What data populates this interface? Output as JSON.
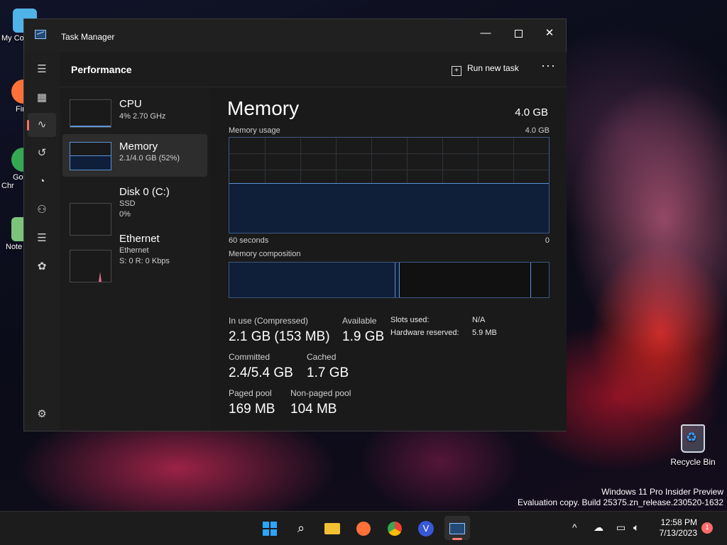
{
  "desktop": {
    "icons": [
      {
        "label": "My Co",
        "color": "#4fb3e8"
      },
      {
        "label": "Fir",
        "color": "#ff7139"
      },
      {
        "label": "Go Chr",
        "color": "#34a853"
      },
      {
        "label": "Note",
        "color": "#7cc47c"
      }
    ],
    "recycle_bin": "Recycle Bin",
    "watermark_line1": "Windows 11 Pro Insider Preview",
    "watermark_line2": "Evaluation copy. Build 25375.zn_release.230520-1632"
  },
  "window": {
    "title": "Task Manager",
    "minimize": "—",
    "close": "✕",
    "page_title": "Performance",
    "run_new_task": "Run new task",
    "more": "···"
  },
  "nav": {
    "menu": "☰",
    "processes": "▦",
    "performance": "∿",
    "app_history": "↺",
    "startup": "◔",
    "users": "⚇",
    "details": "☰",
    "services": "✿",
    "settings": "⚙"
  },
  "resources": [
    {
      "name": "CPU",
      "sub1": "4% 2.70 GHz",
      "sub2": "",
      "level": 0.04
    },
    {
      "name": "Memory",
      "sub1": "2.1/4.0 GB (52%)",
      "sub2": "",
      "level": 0.52
    },
    {
      "name": "Disk 0 (C:)",
      "sub1": "SSD",
      "sub2": "0%",
      "level": 0
    },
    {
      "name": "Ethernet",
      "sub1": "Ethernet",
      "sub2": "S: 0 R: 0 Kbps",
      "level": 0
    }
  ],
  "memory": {
    "title": "Memory",
    "total": "4.0 GB",
    "usage_label": "Memory usage",
    "usage_max": "4.0 GB",
    "usage_level": 0.52,
    "time_left": "60 seconds",
    "time_right": "0",
    "composition_label": "Memory composition",
    "composition": {
      "in_use": 0.52,
      "modified": 0.014,
      "standby": 0.41
    },
    "stats": {
      "in_use_label": "In use (Compressed)",
      "in_use_value": "2.1 GB (153 MB)",
      "available_label": "Available",
      "available_value": "1.9 GB",
      "committed_label": "Committed",
      "committed_value": "2.4/5.4 GB",
      "cached_label": "Cached",
      "cached_value": "1.7 GB",
      "paged_label": "Paged pool",
      "paged_value": "169 MB",
      "nonpaged_label": "Non-paged pool",
      "nonpaged_value": "104 MB",
      "slots_label": "Slots used:",
      "slots_value": "N/A",
      "hw_label": "Hardware reserved:",
      "hw_value": "5.9 MB"
    }
  },
  "taskbar": {
    "time": "12:58 PM",
    "date": "7/13/2023",
    "notifications": "1",
    "chevron": "^"
  },
  "colors": {
    "accent": "#5b92d4",
    "graph_fill": "#0f1f3a",
    "nav_indicator": "#ff6b6b"
  }
}
